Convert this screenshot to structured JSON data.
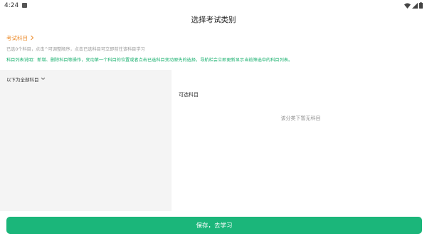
{
  "status_bar": {
    "time": "4:24",
    "icons": [
      "notification-icon",
      "wifi-icon",
      "signal-icon",
      "battery-icon"
    ]
  },
  "header": {
    "title": "选择考试类别"
  },
  "info": {
    "subject_link": "考试科目",
    "selected_hint": "已选0个科目，点击^可调整顺序，点击已选科目可立即前往该科目学习",
    "list_notice": "科目列表说明：新增、删除科目等操作，变动第一个科目的位置或者点击已选科目变动原先的选择，导航栏会立即更新显示当前筛选中的科目列表。",
    "accent_color": "#ec8c2d",
    "notice_color": "#18b06e"
  },
  "left_panel": {
    "dropdown_label": "以下为全部科目"
  },
  "right_panel": {
    "section_label": "可选科目",
    "empty_message": "该分类下暂无科目"
  },
  "footer": {
    "save_label": "保存，去学习",
    "button_color": "#1bb67a"
  }
}
